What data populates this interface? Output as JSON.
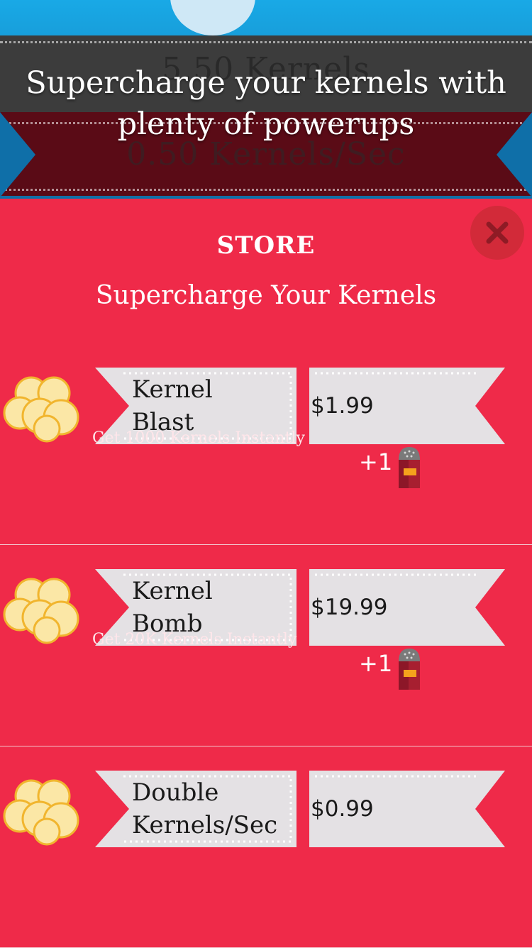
{
  "game": {
    "kernels_counter": "5.50 Kernels",
    "rate_counter": "0.50 Kernels/Sec"
  },
  "caption": {
    "line1": "Supercharge your kernels with",
    "line2": "plenty of powerups"
  },
  "store": {
    "title": "STORE",
    "subtitle": "Supercharge Your Kernels",
    "close_icon": "close-icon",
    "items": [
      {
        "name_line1": "Kernel",
        "name_line2": "Blast",
        "price": "$1.99",
        "description": "Get 1000 Kernels Instantly",
        "bonus": "+1",
        "bonus_icon": "salt-shaker-icon"
      },
      {
        "name_line1": "Kernel",
        "name_line2": "Bomb",
        "price": "$19.99",
        "description": "Get 20K Kernels Instantly",
        "bonus": "+1",
        "bonus_icon": "salt-shaker-icon"
      },
      {
        "name_line1": "Double",
        "name_line2": "Kernels/Sec",
        "price": "$0.99",
        "description": "",
        "bonus": "",
        "bonus_icon": ""
      }
    ]
  },
  "colors": {
    "store_background": "#ef2a49",
    "ribbon": "#e4e1e4",
    "close_button": "#d22a39",
    "popcorn": "#fbe7a6"
  }
}
